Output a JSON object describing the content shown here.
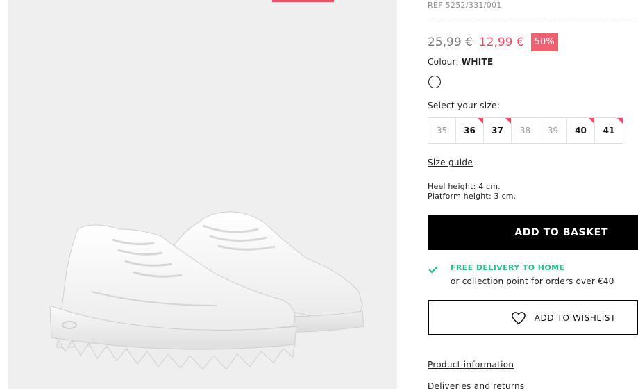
{
  "product": {
    "ref": "REF 5252/331/001",
    "old_price": "25,99 €",
    "new_price": "12,99 €",
    "discount": "50%",
    "colour_label": "Colour:",
    "colour_value": "WHITE",
    "image_icon": "white-chunky-sneakers"
  },
  "sizes": {
    "label": "Select your size:",
    "items": [
      {
        "size": "35",
        "available": false,
        "low_stock": false
      },
      {
        "size": "36",
        "available": true,
        "low_stock": true
      },
      {
        "size": "37",
        "available": true,
        "low_stock": true
      },
      {
        "size": "38",
        "available": false,
        "low_stock": false
      },
      {
        "size": "39",
        "available": false,
        "low_stock": false
      },
      {
        "size": "40",
        "available": true,
        "low_stock": true
      },
      {
        "size": "41",
        "available": true,
        "low_stock": true
      }
    ],
    "guide_label": "Size guide"
  },
  "specs": {
    "heel": "Heel height: 4 cm.",
    "platform": "Platform height: 3 cm."
  },
  "actions": {
    "add_to_basket": "ADD TO BASKET",
    "add_to_wishlist": "ADD TO WISHLIST"
  },
  "delivery": {
    "title": "FREE DELIVERY TO HOME",
    "subtitle": "or collection point for orders over €40"
  },
  "links": {
    "product_information": "Product information",
    "deliveries_returns": "Deliveries and returns"
  },
  "colors": {
    "accent": "#ef4a63",
    "discount_bg": "#f06071",
    "delivery_green": "#2bbd87",
    "image_bg": "#efefef"
  }
}
